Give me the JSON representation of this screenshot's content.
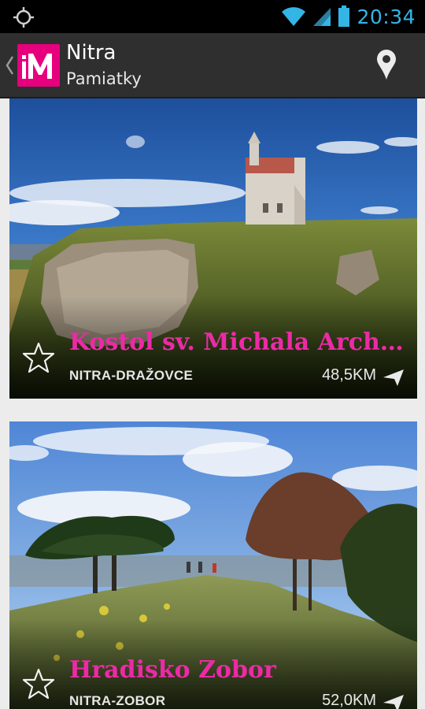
{
  "status_bar": {
    "time": "20:34",
    "icons": [
      "gps-icon",
      "wifi-icon",
      "signal-icon",
      "battery-icon"
    ],
    "accent": "#33b5e5"
  },
  "action_bar": {
    "logo_text": "iM",
    "title": "Nitra",
    "subtitle": "Pamiatky",
    "brand_color": "#e6007e",
    "icons": [
      "back-chevron-icon",
      "map-pin-icon"
    ]
  },
  "places": [
    {
      "name": "Kostol sv. Michala Archa...",
      "location": "NITRA-DRAŽOVCE",
      "distance": "48,5KM",
      "favorite": false
    },
    {
      "name": "Hradisko Zobor",
      "location": "NITRA-ZOBOR",
      "distance": "52,0KM",
      "favorite": false
    }
  ],
  "colors": {
    "title_pink": "#ec2aa6"
  }
}
